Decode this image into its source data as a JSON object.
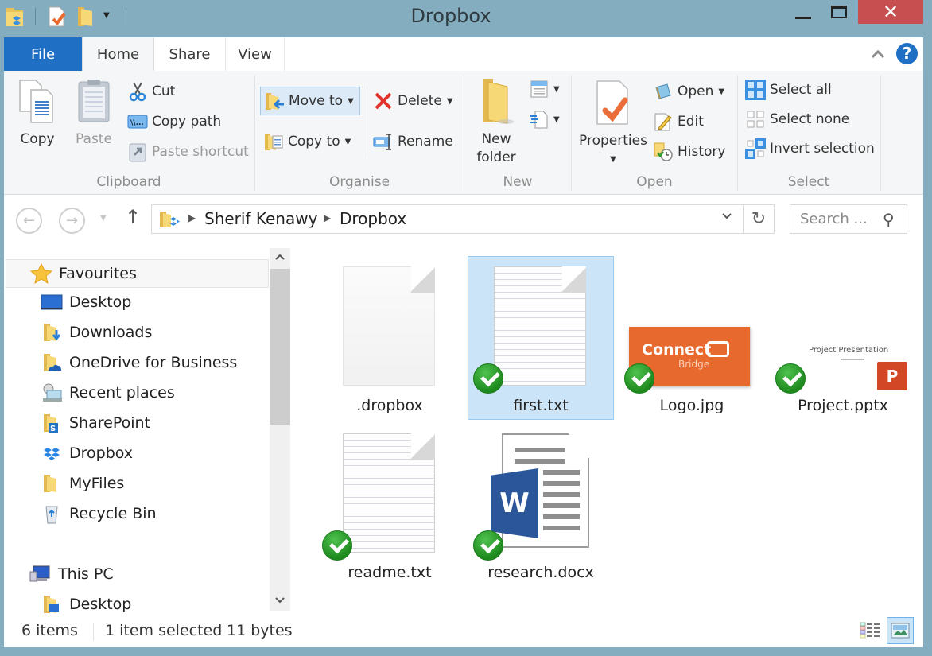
{
  "window": {
    "title": "Dropbox",
    "close_glyph": "✕",
    "quick_access": [
      "folder-sync-icon",
      "properties-icon",
      "new-folder-icon",
      "customize-dropdown"
    ]
  },
  "ribbon": {
    "tabs": [
      {
        "label": "File",
        "active": false
      },
      {
        "label": "Home",
        "active": true
      },
      {
        "label": "Share",
        "active": false
      },
      {
        "label": "View",
        "active": false
      }
    ],
    "collapse_glyph": "^",
    "help_glyph": "?",
    "groups": {
      "clipboard": {
        "label": "Clipboard",
        "copy": "Copy",
        "paste": "Paste",
        "cut": "Cut",
        "copy_path": "Copy path",
        "paste_shortcut": "Paste shortcut"
      },
      "organise": {
        "label": "Organise",
        "move_to": "Move to",
        "copy_to": "Copy to",
        "delete": "Delete",
        "rename": "Rename"
      },
      "new": {
        "label": "New",
        "new_folder_line1": "New",
        "new_folder_line2": "folder"
      },
      "open": {
        "label": "Open",
        "properties": "Properties",
        "open": "Open",
        "edit": "Edit",
        "history": "History"
      },
      "select": {
        "label": "Select",
        "select_all": "Select all",
        "select_none": "Select none",
        "invert_selection": "Invert selection"
      }
    }
  },
  "navigation": {
    "back_glyph": "←",
    "forward_glyph": "→",
    "up_glyph": "↑",
    "breadcrumb": [
      "Sherif Kenawy",
      "Dropbox"
    ],
    "refresh_glyph": "↻",
    "search_placeholder": "Search ..."
  },
  "nav_pane": {
    "favourites_label": "Favourites",
    "favourites": [
      {
        "label": "Desktop",
        "icon": "desktop-icon"
      },
      {
        "label": "Downloads",
        "icon": "downloads-folder-icon"
      },
      {
        "label": "OneDrive for Business",
        "icon": "onedrive-folder-icon"
      },
      {
        "label": "Recent places",
        "icon": "recent-places-icon"
      },
      {
        "label": "SharePoint",
        "icon": "sharepoint-folder-icon"
      },
      {
        "label": "Dropbox",
        "icon": "dropbox-icon"
      },
      {
        "label": "MyFiles",
        "icon": "folder-icon"
      },
      {
        "label": "Recycle Bin",
        "icon": "recycle-bin-icon"
      }
    ],
    "this_pc_label": "This PC",
    "this_pc": [
      {
        "label": "Desktop",
        "icon": "desktop-folder-icon"
      }
    ]
  },
  "files": [
    {
      "name": ".dropbox",
      "type": "blank-file",
      "synced": false,
      "selected": false
    },
    {
      "name": "first.txt",
      "type": "text-file",
      "synced": true,
      "selected": true
    },
    {
      "name": "Logo.jpg",
      "type": "image",
      "synced": true,
      "selected": false,
      "thumb_text": "Connect",
      "thumb_subtext": "Bridge"
    },
    {
      "name": "Project.pptx",
      "type": "powerpoint",
      "synced": true,
      "selected": false,
      "thumb_text": "Project Presentation",
      "app_letter": "P"
    },
    {
      "name": "readme.txt",
      "type": "text-file",
      "synced": true,
      "selected": false
    },
    {
      "name": "research.docx",
      "type": "word",
      "synced": true,
      "selected": false,
      "app_letter": "W"
    }
  ],
  "status": {
    "item_count": "6 items",
    "selection": "1 item selected",
    "size": "11 bytes",
    "view_mode": "large-icons"
  },
  "colors": {
    "file_tab": "#1f6fc4",
    "close_button": "#c74f4f",
    "selection_bg": "#cce4f7",
    "sync_ok": "#2e9b2e",
    "title_bar": "#84aebf"
  }
}
